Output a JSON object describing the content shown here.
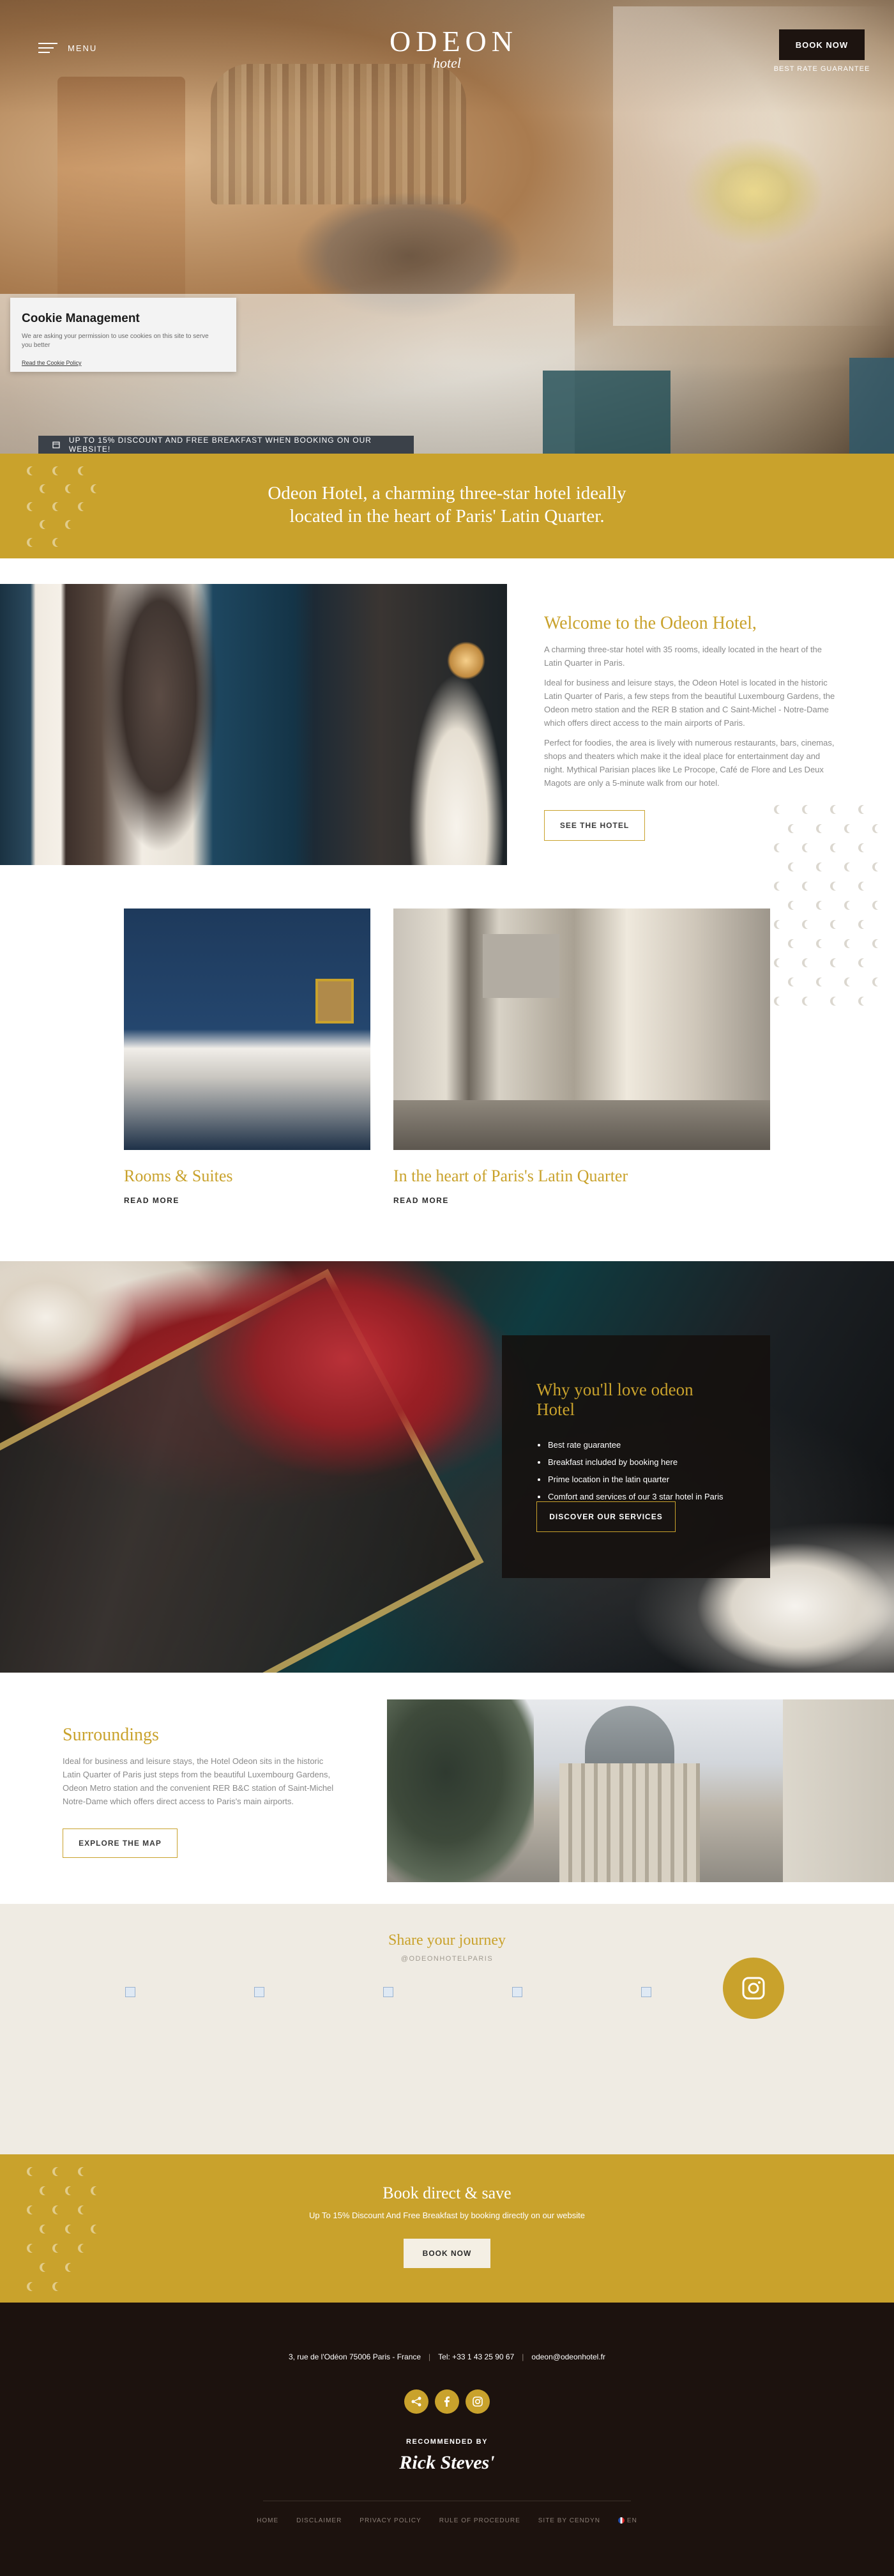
{
  "header": {
    "menu_label": "MENU",
    "logo_main": "ODEON",
    "logo_sub": "hotel",
    "book_now": "BOOK NOW",
    "best_rate": "BEST RATE GUARANTEE"
  },
  "cookie": {
    "title": "Cookie Management",
    "text": "We are asking your permission to use cookies on this site to serve you better",
    "link": "Read the Cookie Policy"
  },
  "promo_bar": "UP TO 15% DISCOUNT AND FREE BREAKFAST WHEN BOOKING ON OUR WEBSITE!",
  "intro": "Odeon Hotel, a charming three-star hotel ideally located in the heart of Paris' Latin Quarter.",
  "welcome": {
    "title": "Welcome to the Odeon Hotel,",
    "p1": "A charming three-star hotel with 35 rooms, ideally located in the heart of the Latin Quarter in Paris.",
    "p2": "Ideal for business and leisure stays, the Odeon Hotel is located in the historic Latin Quarter of Paris, a few steps from the beautiful Luxembourg Gardens, the Odeon metro station and the RER B station and C Saint-Michel - Notre-Dame which offers direct access to the main airports of Paris.",
    "p3": "Perfect for foodies, the area is lively with numerous restaurants, bars, cinemas, shops and theaters which make it the ideal place for entertainment day and night. Mythical Parisian places like Le Procope, Café de Flore and Les Deux Magots are only a 5-minute walk from our hotel.",
    "button": "SEE THE HOTEL"
  },
  "cards": [
    {
      "title": "Rooms & Suites",
      "link": "READ MORE"
    },
    {
      "title": "In the heart of Paris's Latin Quarter",
      "link": "READ MORE"
    }
  ],
  "why": {
    "title": "Why you'll love odeon Hotel",
    "items": [
      "Best rate guarantee",
      "Breakfast included by booking here",
      "Prime location in the latin quarter",
      "Comfort and services of our 3 star hotel in Paris"
    ],
    "button": "DISCOVER OUR SERVICES"
  },
  "surroundings": {
    "title": "Surroundings",
    "text": "Ideal for business and leisure stays, the Hotel Odeon sits in the historic Latin Quarter of Paris just steps from the beautiful Luxembourg Gardens, Odeon Metro station and the convenient RER B&C station of Saint-Michel Notre-Dame which offers direct access to Paris's main airports.",
    "button": "EXPLORE THE MAP"
  },
  "share": {
    "title": "Share your journey",
    "handle": "@ODEONHOTELPARIS"
  },
  "book_direct": {
    "title": "Book direct & save",
    "subtitle": "Up To 15% Discount And Free Breakfast by booking directly on our website",
    "button": "BOOK NOW"
  },
  "footer": {
    "address": "3, rue de l'Odéon 75006 Paris - France",
    "phone": "Tel: +33 1 43 25 90 67",
    "email": "odeon@odeonhotel.fr",
    "recommended": "RECOMMENDED BY",
    "rick": "Rick Steves'",
    "nav": [
      "HOME",
      "DISCLAIMER",
      "PRIVACY POLICY",
      "RULE OF PROCEDURE",
      "SITE BY CENDYN",
      "EN"
    ]
  },
  "colors": {
    "accent": "#c9a22c",
    "dark": "#1c120e",
    "cream": "#efebe3"
  }
}
